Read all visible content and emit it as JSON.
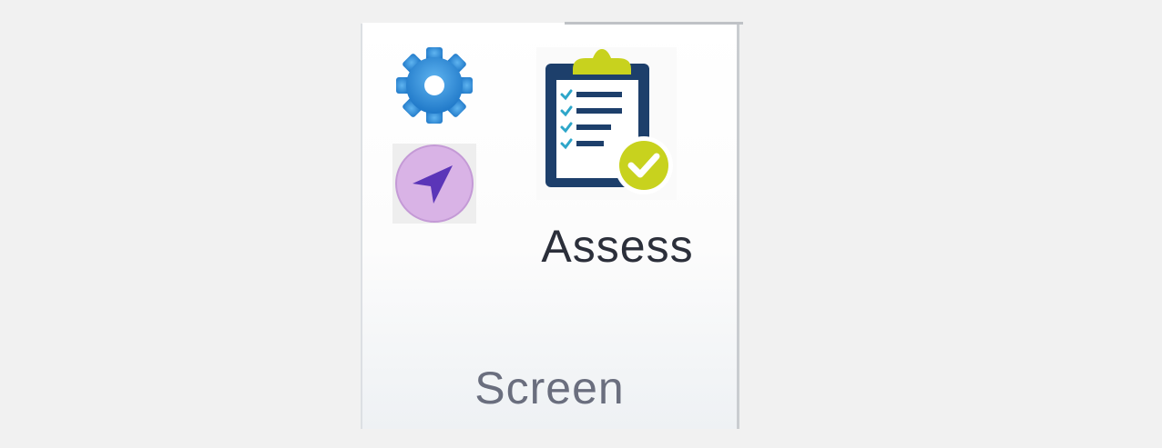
{
  "ribbon_group": {
    "label": "Screen",
    "buttons": {
      "settings": {
        "icon": "gear-icon",
        "color": "#2f8fd8"
      },
      "navigate": {
        "icon": "navigation-arrow-icon",
        "color": "#5b35b8",
        "background": "#d9b3e6"
      },
      "assess": {
        "label": "Assess",
        "icon": "clipboard-checklist-icon",
        "colors": {
          "clipboard": "#1d3f6b",
          "clip": "#c8d21e",
          "check_badge": "#c8d21e",
          "check_marks": "#2da6c9"
        }
      }
    }
  }
}
